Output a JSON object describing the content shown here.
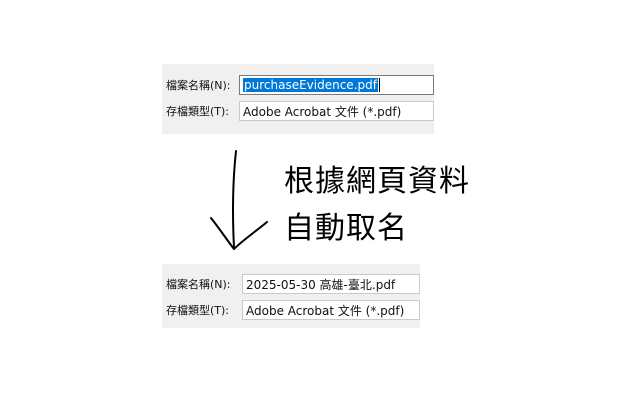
{
  "before": {
    "filename_label": "檔案名稱(N):",
    "filename_value": "purchaseEvidence.pdf",
    "filetype_label": "存檔類型(T):",
    "filetype_value": "Adobe Acrobat 文件 (*.pdf)"
  },
  "caption": {
    "line1": "根據網頁資料",
    "line2": "自動取名"
  },
  "after": {
    "filename_label": "檔案名稱(N):",
    "filename_value": "2025-05-30 高雄-臺北.pdf",
    "filetype_label": "存檔類型(T):",
    "filetype_value": "Adobe Acrobat 文件 (*.pdf)"
  },
  "icons": [
    "hand-drawn-down-arrow-icon"
  ],
  "colors": {
    "selection": "#0078d7",
    "panel_bg": "#f0f0f0"
  }
}
